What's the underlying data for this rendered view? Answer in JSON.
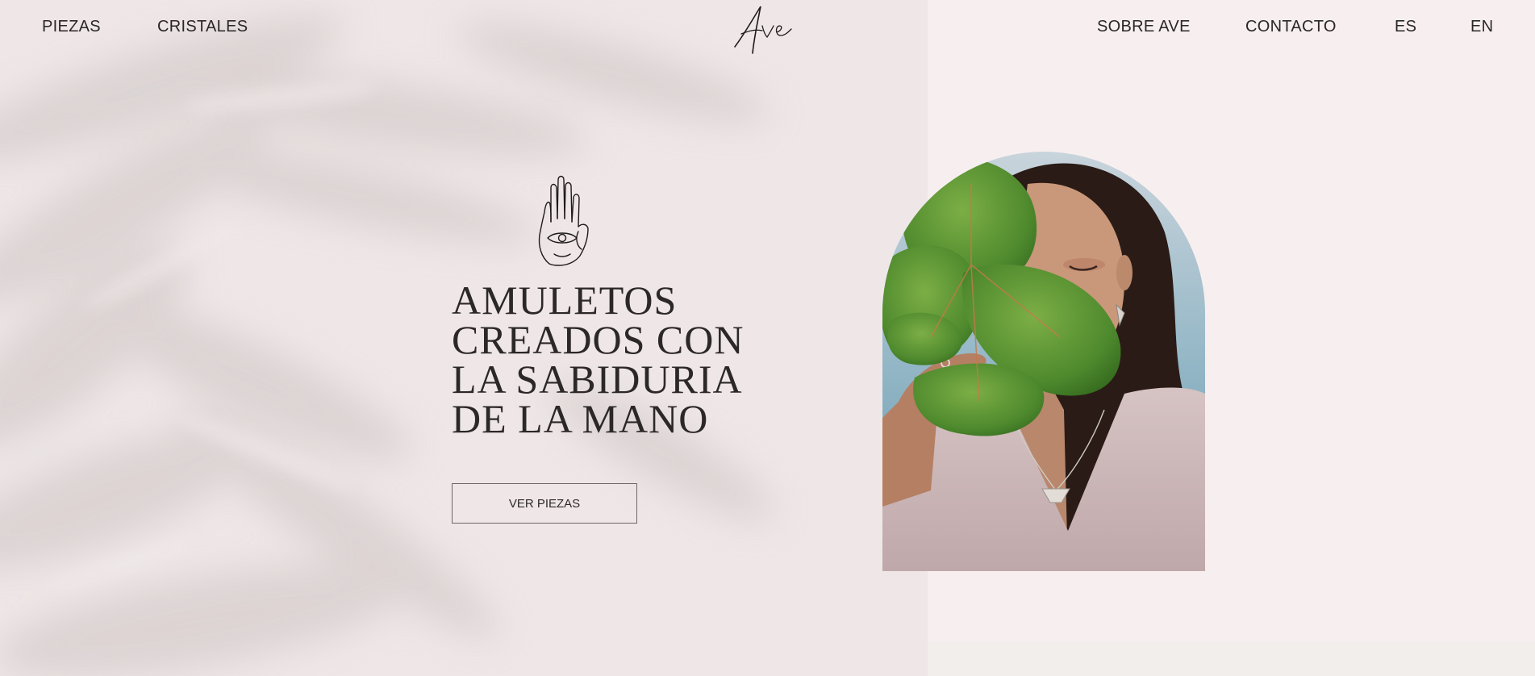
{
  "header": {
    "nav_left": [
      "PIEZAS",
      "CRISTALES"
    ],
    "logo_text": "Ave",
    "nav_right": [
      "SOBRE AVE",
      "CONTACTO"
    ],
    "languages": [
      "ES",
      "EN"
    ]
  },
  "hero": {
    "headline": "AMULETOS CREADOS CON LA SABIDURIA DE LA MANO",
    "cta_label": "VER PIEZAS"
  },
  "colors": {
    "background": "#f6eeee",
    "text": "#2a2626",
    "accent_leaf": "#4f8a2e"
  }
}
